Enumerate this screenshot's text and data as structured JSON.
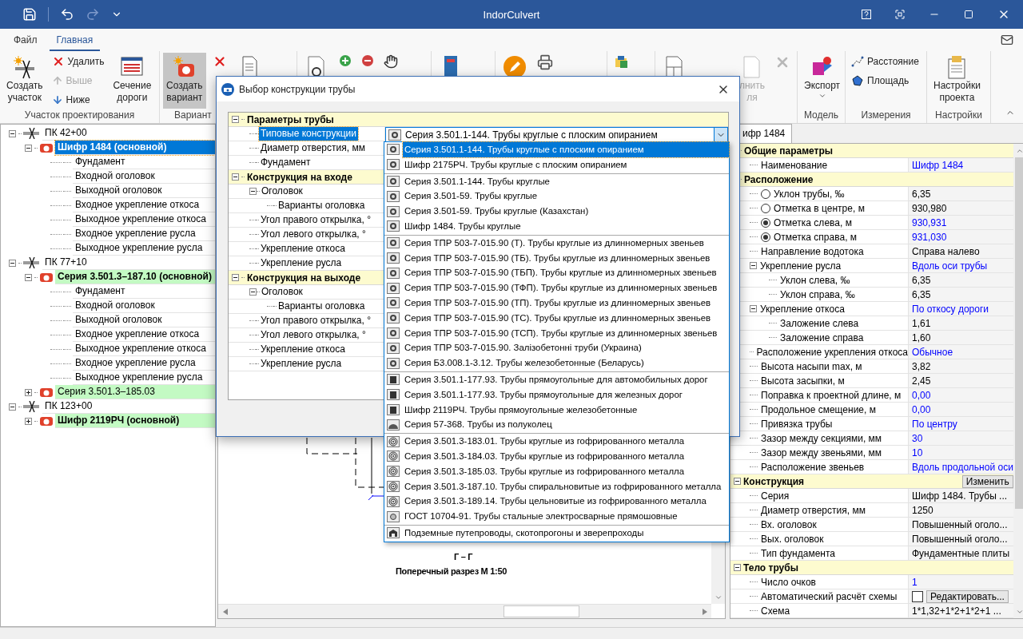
{
  "window": {
    "title": "IndorCulvert"
  },
  "ribbon_tabs": [
    {
      "label": "Файл",
      "selected": false
    },
    {
      "label": "Главная",
      "selected": true
    }
  ],
  "ribbon": {
    "create_section": {
      "lines": [
        "Создать",
        "участок"
      ]
    },
    "delete": {
      "label": "Удалить",
      "disabled": false
    },
    "up": {
      "label": "Выше",
      "disabled": true
    },
    "down": {
      "label": "Ниже",
      "disabled": false
    },
    "road_section": {
      "lines": [
        "Сечение",
        "дороги"
      ]
    },
    "section_group": "Участок проектирования",
    "create_variant": {
      "lines": [
        "Создать",
        "вариант"
      ],
      "selected": true
    },
    "variant_group": "Вариант",
    "fill": {
      "lines": [
        "лнить",
        "ля"
      ],
      "disabled": true
    },
    "export": {
      "lines": [
        "Экспорт"
      ]
    },
    "model_group": "Модель",
    "distance": {
      "label": "Расстояние"
    },
    "area": {
      "label": "Площадь"
    },
    "measure_group": "Измерения",
    "settings": {
      "lines": [
        "Настройки",
        "проекта"
      ]
    },
    "settings_group": "Настройки"
  },
  "project_tree": [
    {
      "kind": "station",
      "label": "ПК 42+00",
      "expanded": true,
      "children": [
        {
          "kind": "variant",
          "label": "Шифр 1484 (основной)",
          "main": true,
          "selected": true,
          "expanded": true,
          "children": [
            {
              "kind": "element",
              "label": "Фундамент"
            },
            {
              "kind": "element",
              "label": "Входной оголовок"
            },
            {
              "kind": "element",
              "label": "Выходной оголовок"
            },
            {
              "kind": "element",
              "label": "Входное укрепление откоса"
            },
            {
              "kind": "element",
              "label": "Выходное укрепление откоса"
            },
            {
              "kind": "element",
              "label": "Входное укрепление русла"
            },
            {
              "kind": "element",
              "label": "Выходное укрепление русла"
            }
          ]
        }
      ]
    },
    {
      "kind": "station",
      "label": "ПК 77+10",
      "expanded": true,
      "children": [
        {
          "kind": "variant",
          "label": "Серия 3.501.3–187.10 (основной)",
          "main": true,
          "selected": false,
          "expanded": true,
          "children": [
            {
              "kind": "element",
              "label": "Фундамент"
            },
            {
              "kind": "element",
              "label": "Входной оголовок"
            },
            {
              "kind": "element",
              "label": "Выходной оголовок"
            },
            {
              "kind": "element",
              "label": "Входное укрепление откоса"
            },
            {
              "kind": "element",
              "label": "Выходное укрепление откоса"
            },
            {
              "kind": "element",
              "label": "Входное укрепление русла"
            },
            {
              "kind": "element",
              "label": "Выходное укрепление русла"
            }
          ]
        },
        {
          "kind": "variant",
          "label": "Серия 3.501.3–185.03",
          "main": false,
          "selected": false,
          "expanded": false
        }
      ]
    },
    {
      "kind": "station",
      "label": "ПК 123+00",
      "expanded": true,
      "children": [
        {
          "kind": "variant",
          "label": "Шифр 2119РЧ (основной)",
          "main": true,
          "selected": false,
          "expanded": false
        }
      ]
    }
  ],
  "canvas": {
    "section_title": "Г – Г",
    "caption": "Поперечный разрез М 1:50"
  },
  "dialog": {
    "title": "Выбор конструкции трубы",
    "sections": [
      {
        "label": "Параметры трубы",
        "expanded": true,
        "rows": [
          {
            "label": "Типовые конструкции",
            "selected": true
          },
          {
            "label": "Диаметр отверстия, мм",
            "selected": false
          },
          {
            "label": "Фундамент",
            "selected": false
          }
        ]
      },
      {
        "label": "Конструкция на входе",
        "expanded": true,
        "rows": [
          {
            "label": "Оголовок",
            "selected": false,
            "expanded": true,
            "children": [
              {
                "label": "Варианты оголовка",
                "selected": false
              }
            ]
          },
          {
            "label": "Угол правого открылка, °",
            "selected": false
          },
          {
            "label": "Угол левого открылка, °",
            "selected": false
          },
          {
            "label": "Укрепление откоса",
            "selected": false
          },
          {
            "label": "Укрепление русла",
            "selected": false
          }
        ]
      },
      {
        "label": "Конструкция на выходе",
        "expanded": true,
        "rows": [
          {
            "label": "Оголовок",
            "selected": false,
            "expanded": true,
            "children": [
              {
                "label": "Варианты оголовка",
                "selected": false
              }
            ]
          },
          {
            "label": "Угол правого открылка, °",
            "selected": false
          },
          {
            "label": "Угол левого открылка, °",
            "selected": false
          },
          {
            "label": "Укрепление откоса",
            "selected": false
          },
          {
            "label": "Укрепление русла",
            "selected": false
          }
        ]
      }
    ],
    "combo": {
      "value": "Серия 3.501.1-144. Трубы круглые с плоским опиранием",
      "kind": "round"
    },
    "dropdown": {
      "groups": [
        [
          {
            "label": "Серия 3.501.1-144. Трубы круглые с плоским опиранием",
            "kind": "round",
            "selected": true
          },
          {
            "label": "Шифр 2175РЧ. Трубы круглые с плоским опиранием",
            "kind": "round",
            "selected": false
          }
        ],
        [
          {
            "label": "Серия 3.501.1-144. Трубы круглые",
            "kind": "round",
            "selected": false
          },
          {
            "label": "Серия 3.501-59. Трубы круглые",
            "kind": "round",
            "selected": false
          },
          {
            "label": "Серия 3.501-59. Трубы круглые (Казахстан)",
            "kind": "round",
            "selected": false
          },
          {
            "label": "Шифр 1484. Трубы круглые",
            "kind": "round",
            "selected": false
          }
        ],
        [
          {
            "label": "Серия ТПР 503-7-015.90 (Т). Трубы круглые из длинномерных звеньев",
            "kind": "round",
            "selected": false
          },
          {
            "label": "Серия ТПР 503-7-015.90 (ТБ). Трубы круглые из длинномерных звеньев",
            "kind": "round",
            "selected": false
          },
          {
            "label": "Серия ТПР 503-7-015.90 (ТБП). Трубы круглые из длинномерных звеньев",
            "kind": "round",
            "selected": false
          },
          {
            "label": "Серия ТПР 503-7-015.90 (ТФП). Трубы круглые из длинномерных звеньев",
            "kind": "round",
            "selected": false
          },
          {
            "label": "Серия ТПР 503-7-015.90 (ТП). Трубы круглые из длинномерных звеньев",
            "kind": "round",
            "selected": false
          },
          {
            "label": "Серия ТПР 503-7-015.90 (ТС). Трубы круглые из длинномерных звеньев",
            "kind": "round",
            "selected": false
          },
          {
            "label": "Серия ТПР 503-7-015.90 (ТСП). Трубы круглые из длинномерных звеньев",
            "kind": "round",
            "selected": false
          },
          {
            "label": "Серия ТПР 503-7-015.90. Залізобетонні труби (Украина)",
            "kind": "round",
            "selected": false
          },
          {
            "label": "Серия Б3.008.1-3.12. Трубы железобетонные (Беларусь)",
            "kind": "round",
            "selected": false
          }
        ],
        [
          {
            "label": "Серия 3.501.1-177.93. Трубы прямоугольные для автомобильных дорог",
            "kind": "rect",
            "selected": false
          },
          {
            "label": "Серия 3.501.1-177.93. Трубы прямоугольные для железных дорог",
            "kind": "rect",
            "selected": false
          },
          {
            "label": "Шифр 2119РЧ. Трубы прямоугольные железобетонные",
            "kind": "rect",
            "selected": false
          },
          {
            "label": "Серия 57-368. Трубы из полуколец",
            "kind": "arch",
            "selected": false
          }
        ],
        [
          {
            "label": "Серия 3.501.3-183.01. Трубы круглые из гофрированного металла",
            "kind": "corrugated",
            "selected": false
          },
          {
            "label": "Серия 3.501.3-184.03. Трубы круглые из гофрированного металла",
            "kind": "corrugated",
            "selected": false
          },
          {
            "label": "Серия 3.501.3-185.03. Трубы круглые из гофрированного металла",
            "kind": "corrugated",
            "selected": false
          },
          {
            "label": "Серия 3.501.3-187.10. Трубы спиральновитые из гофрированного металла",
            "kind": "corrugated",
            "selected": false
          },
          {
            "label": "Серия 3.501.3-189.14. Трубы цельновитые из гофрированного металла",
            "kind": "corrugated",
            "selected": false
          },
          {
            "label": "ГОСТ 10704-91. Трубы стальные электросварные прямошовные",
            "kind": "steel",
            "selected": false
          }
        ],
        [
          {
            "label": "Подземные путепроводы, скотопрогоны и зверепроходы",
            "kind": "tunnel",
            "selected": false
          }
        ]
      ]
    }
  },
  "properties": {
    "tab": "ифр 1484",
    "sections": [
      {
        "label": "Общие параметры",
        "rows": [
          {
            "label": "Наименование",
            "value": "Шифр 1484",
            "color": "#0000ff"
          }
        ]
      },
      {
        "label": "Расположение",
        "rows": [
          {
            "kind": "radio",
            "label": "Уклон трубы, ‰",
            "value": "6,35",
            "color": "#000000",
            "checked": false
          },
          {
            "kind": "radio",
            "label": "Отметка в центре, м",
            "value": "930,980",
            "color": "#000000",
            "checked": false
          },
          {
            "kind": "radio",
            "label": "Отметка слева, м",
            "value": "930,931",
            "color": "#0000ff",
            "checked": true
          },
          {
            "kind": "radio",
            "label": "Отметка справа, м",
            "value": "931,030",
            "color": "#0000ff",
            "checked": true
          },
          {
            "label": "Направление водотока",
            "value": "Справа налево",
            "color": "#000000"
          },
          {
            "label": "Укрепление русла",
            "value": "Вдоль оси трубы",
            "color": "#0000ff",
            "expanded": true,
            "children": [
              {
                "label": "Уклон слева, ‰",
                "value": "6,35",
                "color": "#000000"
              },
              {
                "label": "Уклон справа, ‰",
                "value": "6,35",
                "color": "#000000"
              }
            ]
          },
          {
            "label": "Укрепление откоса",
            "value": "По откосу дороги",
            "color": "#0000ff",
            "expanded": true,
            "children": [
              {
                "label": "Заложение слева",
                "value": "1,61",
                "color": "#000000"
              },
              {
                "label": "Заложение справа",
                "value": "1,60",
                "color": "#000000"
              }
            ]
          },
          {
            "label": "Расположение укрепления откоса",
            "value": "Обычное",
            "color": "#0000ff"
          },
          {
            "label": "Высота насыпи max, м",
            "value": "3,82",
            "color": "#000000"
          },
          {
            "label": "Высота засыпки, м",
            "value": "2,45",
            "color": "#000000"
          },
          {
            "label": "Поправка к проектной длине, м",
            "value": "0,00",
            "color": "#0000ff"
          },
          {
            "label": "Продольное смещение, м",
            "value": "0,00",
            "color": "#0000ff"
          },
          {
            "label": "Привязка трубы",
            "value": "По центру",
            "color": "#0000ff"
          },
          {
            "label": "Зазор между секциями, мм",
            "value": "30",
            "color": "#0000ff"
          },
          {
            "label": "Зазор между звеньями, мм",
            "value": "10",
            "color": "#0000ff"
          },
          {
            "label": "Расположение звеньев",
            "value": "Вдоль продольной оси",
            "color": "#0000ff"
          }
        ]
      },
      {
        "label": "Конструкция",
        "expanded": true,
        "button": "Изменить",
        "rows": [
          {
            "label": "Серия",
            "value": "Шифр 1484. Трубы ...",
            "color": "#000000"
          },
          {
            "label": "Диаметр отверстия, мм",
            "value": "1250",
            "color": "#000000"
          },
          {
            "label": "Вх. оголовок",
            "value": "Повышенный оголо...",
            "color": "#000000"
          },
          {
            "label": "Вых. оголовок",
            "value": "Повышенный оголо...",
            "color": "#000000"
          },
          {
            "label": "Тип фундамента",
            "value": "Фундаментные плиты",
            "color": "#000000"
          }
        ]
      },
      {
        "label": "Тело трубы",
        "expanded": true,
        "rows": [
          {
            "label": "Число очков",
            "value": "1",
            "color": "#0000ff"
          },
          {
            "kind": "checkbox",
            "label": "Автоматический расчёт схемы",
            "checked": false,
            "button": "Редактировать..."
          },
          {
            "label": "Схема",
            "value": "1*1,32+1*2+1*2+1 ...",
            "color": "#000000"
          }
        ]
      }
    ]
  }
}
